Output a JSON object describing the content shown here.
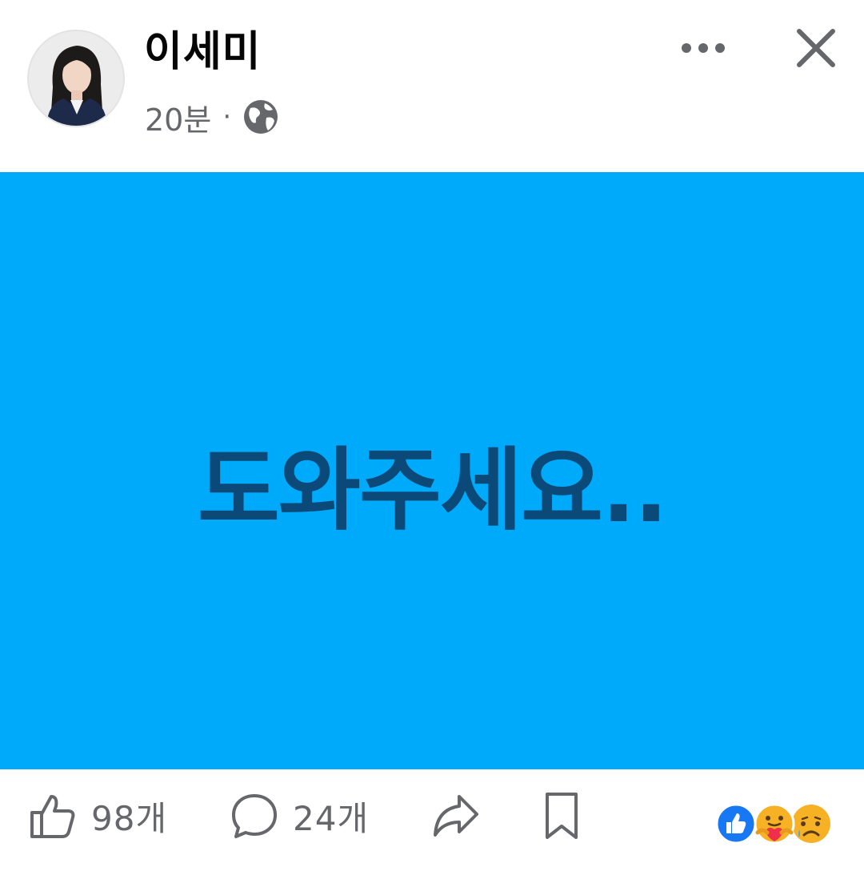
{
  "post": {
    "author": "이세미",
    "time": "20분",
    "separator": "·",
    "privacy_icon": "globe-icon",
    "content_text": "도와주세요..",
    "background_color": "#00AAFB",
    "text_color": "#0B4A78"
  },
  "header": {
    "more_icon": "more-horizontal-icon",
    "close_icon": "close-icon"
  },
  "actions": {
    "like_count": "98개",
    "comment_count": "24개",
    "share_icon": "share-icon",
    "save_icon": "bookmark-icon",
    "reaction_icons": [
      "like-reaction-icon",
      "care-reaction-icon",
      "sad-reaction-icon"
    ]
  },
  "colors": {
    "secondary_text": "#65676B",
    "primary_text": "#050505",
    "like_blue": "#1877F2"
  }
}
